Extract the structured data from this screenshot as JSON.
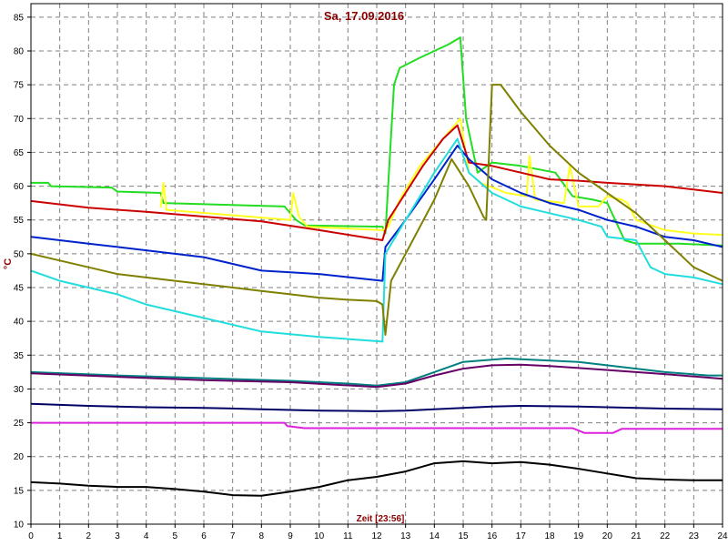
{
  "chart_data": {
    "type": "line",
    "title": "Sa, 17.09.2016",
    "xlabel": "Zeit [23:56]",
    "ylabel": "°C",
    "xlim": [
      0,
      24
    ],
    "ylim": [
      10,
      87
    ],
    "xticks": [
      0,
      1,
      2,
      3,
      4,
      5,
      6,
      7,
      8,
      9,
      10,
      11,
      12,
      13,
      14,
      15,
      16,
      17,
      18,
      19,
      20,
      21,
      22,
      23,
      24
    ],
    "yticks": [
      10,
      15,
      20,
      25,
      30,
      35,
      40,
      45,
      50,
      55,
      60,
      65,
      70,
      75,
      80,
      85
    ],
    "grid": true,
    "colors": {
      "title": "#8b0000",
      "axis_label": "#8b0000",
      "frame": "#000000",
      "grid": "#7f7f7f"
    },
    "series": [
      {
        "color": "#22dd22",
        "points": [
          [
            0,
            60.5
          ],
          [
            0.6,
            60.5
          ],
          [
            0.7,
            60
          ],
          [
            2.8,
            59.8
          ],
          [
            3,
            59.2
          ],
          [
            4.5,
            59
          ],
          [
            4.6,
            57.5
          ],
          [
            8.8,
            57
          ],
          [
            9.2,
            55
          ],
          [
            9.5,
            54.2
          ],
          [
            12.2,
            54
          ],
          [
            12.3,
            53
          ],
          [
            12.6,
            75
          ],
          [
            12.8,
            77.5
          ],
          [
            13.5,
            79
          ],
          [
            14.5,
            81
          ],
          [
            14.9,
            82
          ],
          [
            15.1,
            70
          ],
          [
            15.5,
            62
          ],
          [
            16,
            63.5
          ],
          [
            17,
            63
          ],
          [
            18.2,
            62
          ],
          [
            18.8,
            58.5
          ],
          [
            19.5,
            58
          ],
          [
            20,
            57.5
          ],
          [
            20.6,
            52
          ],
          [
            21,
            51.5
          ],
          [
            22.5,
            51.5
          ],
          [
            24,
            51.2
          ]
        ]
      },
      {
        "color": "#ffff22",
        "points": [
          [
            4.5,
            56.8
          ],
          [
            4.6,
            60.5
          ],
          [
            4.7,
            56.5
          ],
          [
            9,
            55
          ],
          [
            9.1,
            59
          ],
          [
            9.3,
            55.5
          ],
          [
            9.6,
            54
          ],
          [
            12.2,
            53.5
          ],
          [
            12.4,
            54
          ],
          [
            12.8,
            58
          ],
          [
            13.5,
            63
          ],
          [
            14.5,
            68
          ],
          [
            14.9,
            70
          ],
          [
            15.2,
            62
          ],
          [
            15.6,
            60.5
          ],
          [
            16.5,
            59
          ],
          [
            17.2,
            58.5
          ],
          [
            17.3,
            64.5
          ],
          [
            17.5,
            58
          ],
          [
            18.5,
            57.5
          ],
          [
            18.7,
            63
          ],
          [
            19,
            57
          ],
          [
            19.7,
            57
          ],
          [
            20,
            58.5
          ],
          [
            20.5,
            58
          ],
          [
            20.7,
            57.5
          ],
          [
            21,
            55
          ],
          [
            22,
            53.5
          ],
          [
            23,
            53
          ],
          [
            24,
            52.8
          ]
        ]
      },
      {
        "color": "#cc0000",
        "points": [
          [
            0,
            57.8
          ],
          [
            2,
            56.8
          ],
          [
            4,
            56.2
          ],
          [
            6,
            55.5
          ],
          [
            8,
            54.8
          ],
          [
            10,
            53.5
          ],
          [
            12.2,
            52
          ],
          [
            12.4,
            55
          ],
          [
            13,
            59
          ],
          [
            13.6,
            63
          ],
          [
            14.3,
            67
          ],
          [
            14.8,
            69
          ],
          [
            15.2,
            63.5
          ],
          [
            16,
            63
          ],
          [
            17,
            62
          ],
          [
            18,
            61
          ],
          [
            19,
            60.8
          ],
          [
            20,
            60.5
          ],
          [
            22,
            60
          ],
          [
            24,
            59
          ]
        ]
      },
      {
        "color": "#0022cc",
        "points": [
          [
            0,
            52.5
          ],
          [
            1,
            52
          ],
          [
            2,
            51.5
          ],
          [
            3,
            51
          ],
          [
            4,
            50.5
          ],
          [
            5,
            50
          ],
          [
            6,
            49.5
          ],
          [
            7,
            48.5
          ],
          [
            8,
            47.5
          ],
          [
            10,
            47
          ],
          [
            12.2,
            46
          ],
          [
            12.3,
            51
          ],
          [
            13,
            55
          ],
          [
            14,
            61
          ],
          [
            14.8,
            66
          ],
          [
            15.2,
            64
          ],
          [
            16,
            61
          ],
          [
            17,
            59
          ],
          [
            18,
            57.5
          ],
          [
            19,
            56.5
          ],
          [
            20,
            55
          ],
          [
            21,
            54
          ],
          [
            22,
            52.5
          ],
          [
            23,
            52
          ],
          [
            24,
            51
          ]
        ]
      },
      {
        "color": "#22dddd",
        "points": [
          [
            0,
            47.5
          ],
          [
            1,
            46
          ],
          [
            2,
            45
          ],
          [
            3,
            44
          ],
          [
            4,
            42.5
          ],
          [
            5,
            41.5
          ],
          [
            6,
            40.5
          ],
          [
            7,
            39.5
          ],
          [
            8,
            38.5
          ],
          [
            10,
            37.7
          ],
          [
            12.2,
            37
          ],
          [
            12.3,
            50
          ],
          [
            13,
            55
          ],
          [
            14,
            62
          ],
          [
            14.8,
            67
          ],
          [
            15.2,
            62
          ],
          [
            16,
            59
          ],
          [
            17,
            57
          ],
          [
            18,
            56
          ],
          [
            19,
            55
          ],
          [
            19.8,
            54
          ],
          [
            20,
            52.5
          ],
          [
            21,
            52
          ],
          [
            21.5,
            48
          ],
          [
            22,
            47
          ],
          [
            23,
            46.5
          ],
          [
            24,
            45.5
          ]
        ]
      },
      {
        "color": "#808000",
        "points": [
          [
            0,
            50
          ],
          [
            1,
            49
          ],
          [
            2,
            48
          ],
          [
            3,
            47
          ],
          [
            4,
            46.5
          ],
          [
            5,
            46
          ],
          [
            6,
            45.5
          ],
          [
            7,
            45
          ],
          [
            8,
            44.5
          ],
          [
            9,
            44
          ],
          [
            10,
            43.5
          ],
          [
            11,
            43.2
          ],
          [
            12,
            43
          ],
          [
            12.2,
            42.5
          ],
          [
            12.3,
            38
          ],
          [
            12.5,
            46
          ],
          [
            13,
            50
          ],
          [
            14,
            58
          ],
          [
            14.6,
            64
          ],
          [
            15.2,
            60
          ],
          [
            15.7,
            55.5
          ],
          [
            15.8,
            55
          ],
          [
            16,
            75
          ],
          [
            16.3,
            75
          ],
          [
            17,
            71
          ],
          [
            18,
            66
          ],
          [
            19,
            62
          ],
          [
            20,
            59
          ],
          [
            21,
            56
          ],
          [
            22,
            52
          ],
          [
            23,
            48
          ],
          [
            24,
            46
          ]
        ]
      },
      {
        "color": "#008080",
        "points": [
          [
            0,
            32.5
          ],
          [
            3,
            32
          ],
          [
            6,
            31.6
          ],
          [
            9,
            31.2
          ],
          [
            11,
            30.8
          ],
          [
            12,
            30.5
          ],
          [
            13,
            31
          ],
          [
            14,
            32.5
          ],
          [
            15,
            34
          ],
          [
            16.5,
            34.5
          ],
          [
            18,
            34.2
          ],
          [
            19,
            34
          ],
          [
            21,
            33
          ],
          [
            22,
            32.5
          ],
          [
            23.5,
            32
          ],
          [
            24,
            32
          ]
        ]
      },
      {
        "color": "#660066",
        "points": [
          [
            0,
            32.3
          ],
          [
            3,
            31.8
          ],
          [
            6,
            31.3
          ],
          [
            9,
            31
          ],
          [
            12,
            30.3
          ],
          [
            13,
            30.8
          ],
          [
            14,
            32
          ],
          [
            15,
            33
          ],
          [
            16,
            33.5
          ],
          [
            17,
            33.6
          ],
          [
            18,
            33.4
          ],
          [
            19,
            33.1
          ],
          [
            21,
            32.5
          ],
          [
            22,
            32.2
          ],
          [
            24,
            31.5
          ]
        ]
      },
      {
        "color": "#000066",
        "points": [
          [
            0,
            27.8
          ],
          [
            2,
            27.5
          ],
          [
            4,
            27.3
          ],
          [
            6,
            27.2
          ],
          [
            8,
            27
          ],
          [
            10,
            26.8
          ],
          [
            12,
            26.7
          ],
          [
            13,
            26.8
          ],
          [
            14,
            27
          ],
          [
            15,
            27.2
          ],
          [
            16,
            27.4
          ],
          [
            17,
            27.5
          ],
          [
            19,
            27.4
          ],
          [
            20,
            27.3
          ],
          [
            22,
            27.1
          ],
          [
            24,
            27
          ]
        ]
      },
      {
        "color": "#dd22dd",
        "points": [
          [
            0,
            25
          ],
          [
            8.8,
            25
          ],
          [
            8.9,
            24.5
          ],
          [
            9.5,
            24.2
          ],
          [
            12,
            24.2
          ],
          [
            14,
            24.2
          ],
          [
            15.5,
            24.2
          ],
          [
            18.8,
            24.2
          ],
          [
            19.2,
            23.5
          ],
          [
            20.2,
            23.5
          ],
          [
            20.5,
            24.1
          ],
          [
            24,
            24.1
          ]
        ]
      },
      {
        "color": "#000000",
        "points": [
          [
            0,
            16.2
          ],
          [
            1,
            16
          ],
          [
            2,
            15.7
          ],
          [
            3,
            15.5
          ],
          [
            4,
            15.5
          ],
          [
            5,
            15.2
          ],
          [
            6,
            14.8
          ],
          [
            7,
            14.3
          ],
          [
            8,
            14.2
          ],
          [
            9,
            14.8
          ],
          [
            10,
            15.5
          ],
          [
            11,
            16.5
          ],
          [
            12,
            17
          ],
          [
            13,
            17.8
          ],
          [
            14,
            19
          ],
          [
            15,
            19.3
          ],
          [
            16,
            19
          ],
          [
            17,
            19.2
          ],
          [
            18,
            18.8
          ],
          [
            19,
            18.2
          ],
          [
            20,
            17.5
          ],
          [
            21,
            16.8
          ],
          [
            22,
            16.6
          ],
          [
            23,
            16.5
          ],
          [
            24,
            16.5
          ]
        ]
      }
    ]
  }
}
